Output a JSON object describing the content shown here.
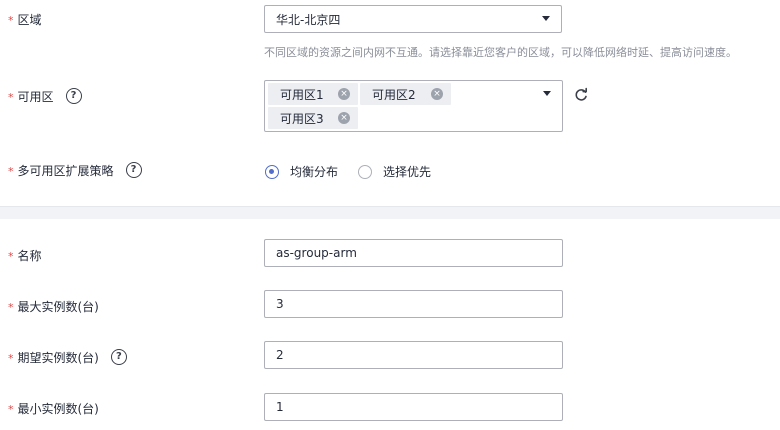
{
  "region": {
    "label": "区域",
    "value": "华北-北京四",
    "hint": "不同区域的资源之间内网不互通。请选择靠近您客户的区域，可以降低网络时延、提高访问速度。"
  },
  "az": {
    "label": "可用区",
    "chips": [
      "可用区1",
      "可用区2",
      "可用区3"
    ]
  },
  "policy": {
    "label": "多可用区扩展策略",
    "options": [
      {
        "label": "均衡分布",
        "selected": true
      },
      {
        "label": "选择优先",
        "selected": false
      }
    ]
  },
  "form": {
    "name_label": "名称",
    "name_value": "as-group-arm",
    "max_label": "最大实例数(台)",
    "max_value": "3",
    "expected_label": "期望实例数(台)",
    "expected_value": "2",
    "min_label": "最小实例数(台)",
    "min_value": "1"
  },
  "common": {
    "required_mark": "*",
    "help_glyph": "?",
    "remove_glyph": "×"
  },
  "colors": {
    "required": "#e24a4a",
    "accent": "#526ecc",
    "border": "#adb0b8"
  }
}
